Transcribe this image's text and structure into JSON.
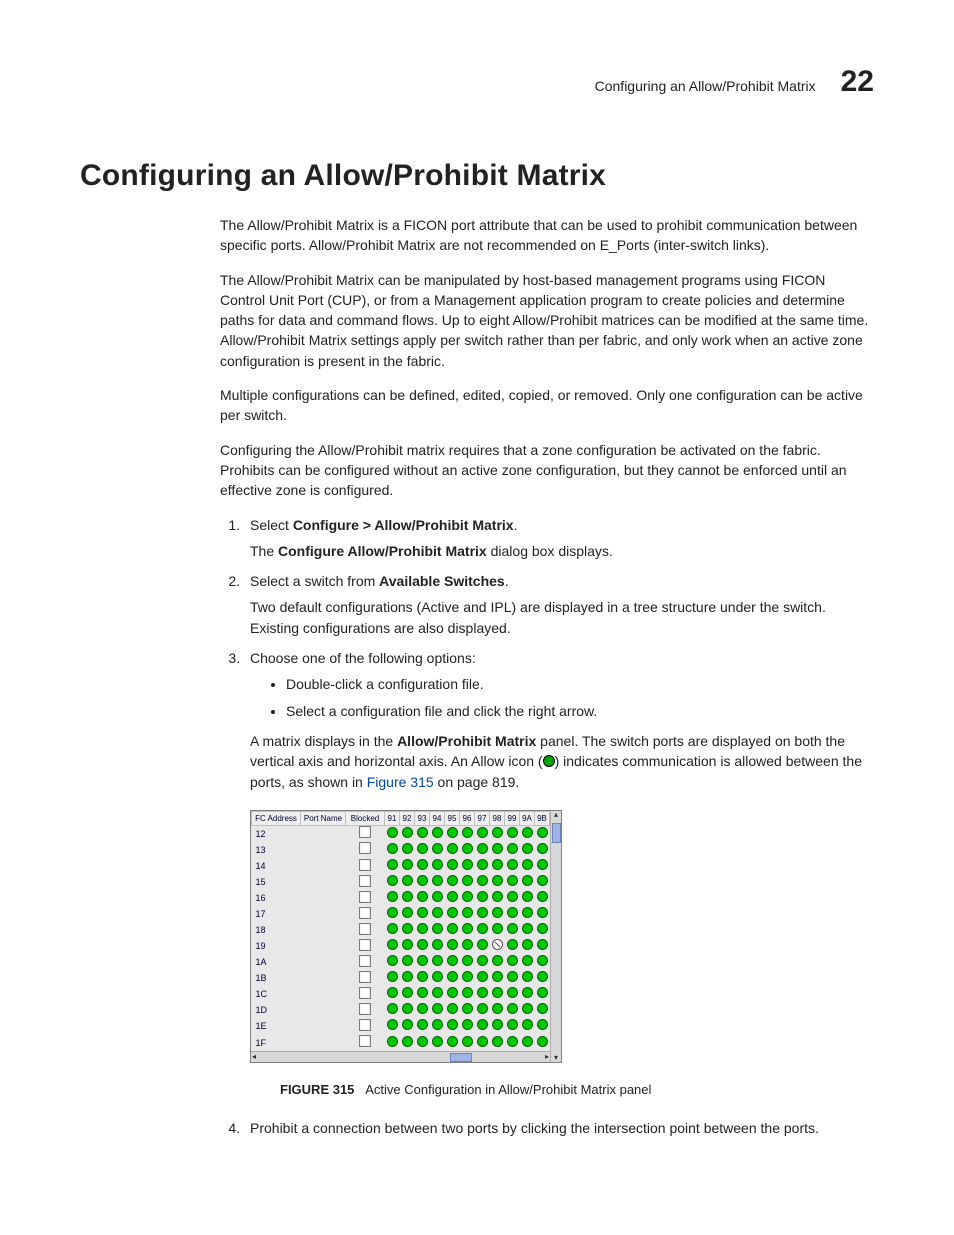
{
  "header": {
    "title": "Configuring an Allow/Prohibit Matrix",
    "chapter": "22"
  },
  "h1": "Configuring an Allow/Prohibit Matrix",
  "p1": "The Allow/Prohibit Matrix is a FICON port attribute that can be used to prohibit communication between specific ports. Allow/Prohibit Matrix are not recommended on E_Ports (inter-switch links).",
  "p2": "The Allow/Prohibit Matrix can be manipulated by host-based management programs using FICON Control Unit Port (CUP), or from a Management application program to create policies and determine paths for data and command flows. Up to eight Allow/Prohibit matrices can be modified at the same time. Allow/Prohibit Matrix settings apply per switch rather than per fabric, and only work when an active zone configuration is present in the fabric.",
  "p3": "Multiple configurations can be defined, edited, copied, or removed. Only one configuration can be active per switch.",
  "p4": "Configuring the Allow/Prohibit matrix requires that a zone configuration be activated on the fabric. Prohibits can be configured without an active zone configuration, but they cannot be enforced until an effective zone is configured.",
  "step1a": "Select ",
  "step1b": "Configure > Allow/Prohibit Matrix",
  "step1c": ".",
  "step1p_a": "The ",
  "step1p_b": "Configure Allow/Prohibit Matrix",
  "step1p_c": " dialog box displays.",
  "step2a": "Select a switch from ",
  "step2b": "Available Switches",
  "step2c": ".",
  "step2p": "Two default configurations (Active and IPL) are displayed in a tree structure under the switch. Existing configurations are also displayed.",
  "step3": "Choose one of the following options:",
  "step3b1": "Double-click a configuration file.",
  "step3b2": "Select a configuration file and click the right arrow.",
  "step3p_a": "A matrix displays in the ",
  "step3p_b": "Allow/Prohibit Matrix",
  "step3p_c": " panel. The switch ports are displayed on both the vertical axis and horizontal axis. An Allow icon (",
  "step3p_d": ") indicates communication is allowed between the ports, as shown in ",
  "step3p_link": "Figure 315",
  "step3p_e": " on page 819.",
  "fig": {
    "label": "FIGURE 315",
    "caption": "Active Configuration in Allow/Prohibit Matrix panel"
  },
  "step4": "Prohibit a connection between two ports by clicking the intersection point between the ports.",
  "matrix": {
    "headers": [
      "FC Address",
      "Port Name",
      "Blocked",
      "91",
      "92",
      "93",
      "94",
      "95",
      "96",
      "97",
      "98",
      "99",
      "9A",
      "9B"
    ],
    "rows": [
      "12",
      "13",
      "14",
      "15",
      "16",
      "17",
      "18",
      "19",
      "1A",
      "1B",
      "1C",
      "1D",
      "1E",
      "1F"
    ],
    "prohibit": {
      "row": "19",
      "colIndex": 7
    },
    "cols": 11
  }
}
